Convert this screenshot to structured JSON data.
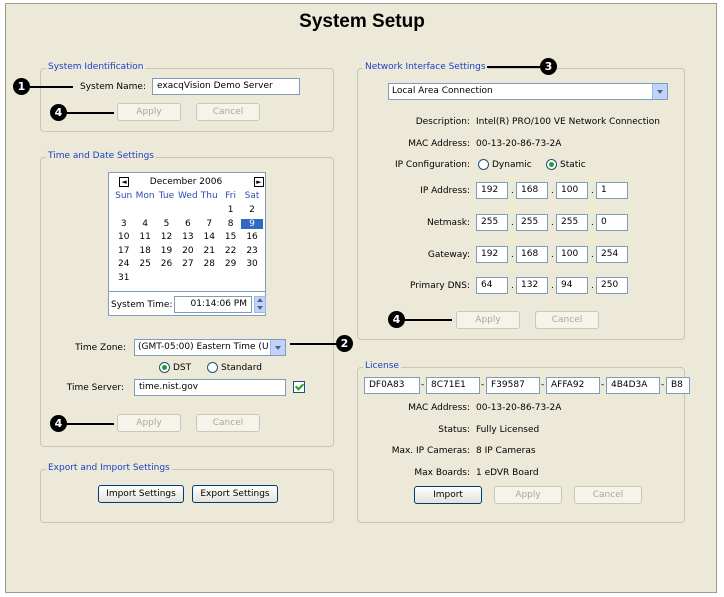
{
  "page_title": "System Setup",
  "system_identification": {
    "legend": "System Identification",
    "system_name_label": "System Name:",
    "system_name_value": "exacqVision Demo Server",
    "apply": "Apply",
    "cancel": "Cancel"
  },
  "time_date": {
    "legend": "Time and Date Settings",
    "calendar": {
      "month_year": "December 2006",
      "prev": "◄",
      "next": "►",
      "day_names": [
        "Sun",
        "Mon",
        "Tue",
        "Wed",
        "Thu",
        "Fri",
        "Sat"
      ],
      "weeks": [
        [
          "",
          "",
          "",
          "",
          "",
          "1",
          "2"
        ],
        [
          "3",
          "4",
          "5",
          "6",
          "7",
          "8",
          "9"
        ],
        [
          "10",
          "11",
          "12",
          "13",
          "14",
          "15",
          "16"
        ],
        [
          "17",
          "18",
          "19",
          "20",
          "21",
          "22",
          "23"
        ],
        [
          "24",
          "25",
          "26",
          "27",
          "28",
          "29",
          "30"
        ],
        [
          "31",
          "",
          "",
          "",
          "",
          "",
          ""
        ]
      ],
      "selected_day": "9"
    },
    "system_time_label": "System Time:",
    "system_time_value": "01:14:06 PM",
    "time_zone_label": "Time Zone:",
    "time_zone_value": "(GMT-05:00) Eastern Time (U",
    "dst_label": "DST",
    "standard_label": "Standard",
    "time_server_label": "Time Server:",
    "time_server_value": "time.nist.gov",
    "apply": "Apply",
    "cancel": "Cancel"
  },
  "export_import": {
    "legend": "Export and Import Settings",
    "import": "Import Settings",
    "export": "Export Settings"
  },
  "network": {
    "legend": "Network Interface Settings",
    "adapter": "Local Area Connection",
    "description_label": "Description:",
    "description_value": "Intel(R) PRO/100 VE Network Connection",
    "mac_label": "MAC Address:",
    "mac_value": "00-13-20-86-73-2A",
    "ipconf_label": "IP Configuration:",
    "dynamic_label": "Dynamic",
    "static_label": "Static",
    "ip_label": "IP Address:",
    "ip": [
      "192",
      "168",
      "100",
      "1"
    ],
    "netmask_label": "Netmask:",
    "netmask": [
      "255",
      "255",
      "255",
      "0"
    ],
    "gateway_label": "Gateway:",
    "gateway": [
      "192",
      "168",
      "100",
      "254"
    ],
    "dns_label": "Primary DNS:",
    "dns": [
      "64",
      "132",
      "94",
      "250"
    ],
    "apply": "Apply",
    "cancel": "Cancel"
  },
  "license": {
    "legend": "License",
    "keys": [
      "DF0A83",
      "8C71E1",
      "F39587",
      "AFFA92",
      "4B4D3A",
      "B8"
    ],
    "mac_label": "MAC Address:",
    "mac_value": "00-13-20-86-73-2A",
    "status_label": "Status:",
    "status_value": "Fully Licensed",
    "cameras_label": "Max. IP Cameras:",
    "cameras_value": "8 IP Cameras",
    "boards_label": "Max Boards:",
    "boards_value": "1 eDVR Board",
    "import": "Import",
    "apply": "Apply",
    "cancel": "Cancel"
  },
  "callouts": [
    "1",
    "2",
    "3",
    "4",
    "4",
    "4"
  ],
  "colors": {
    "legend": "#1c41c7",
    "window": "#ece9d8",
    "selected": "#316ac5"
  }
}
